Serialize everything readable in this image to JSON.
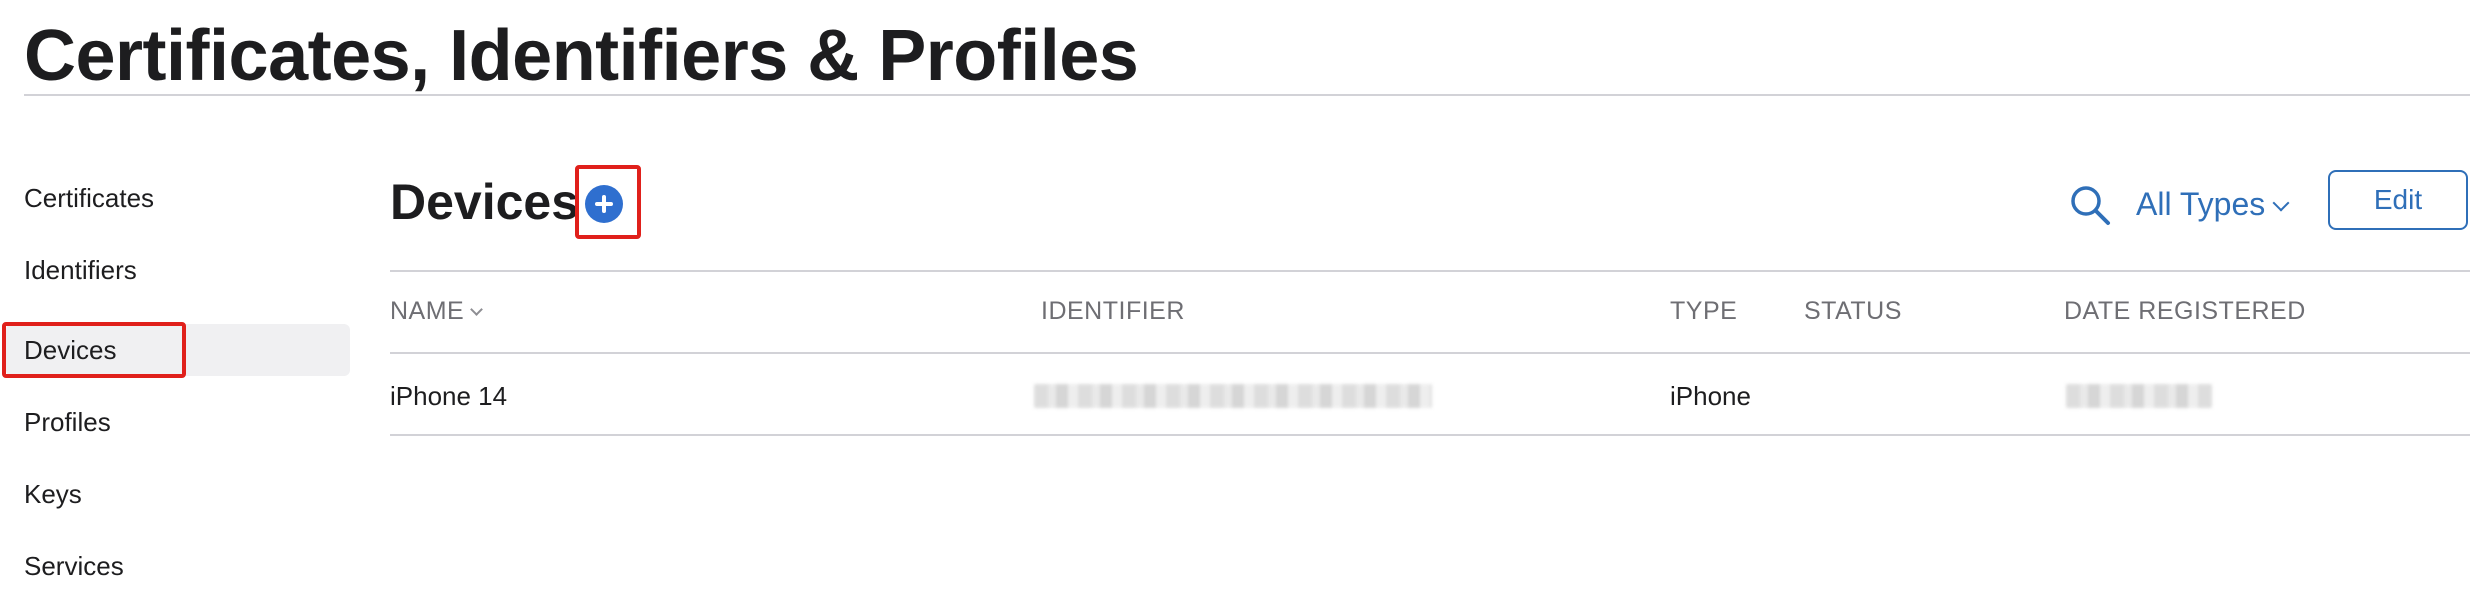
{
  "header": {
    "title": "Certificates, Identifiers & Profiles"
  },
  "sidebar": {
    "items": [
      {
        "label": "Certificates",
        "active": false
      },
      {
        "label": "Identifiers",
        "active": false
      },
      {
        "label": "Devices",
        "active": true
      },
      {
        "label": "Profiles",
        "active": false
      },
      {
        "label": "Keys",
        "active": false
      },
      {
        "label": "Services",
        "active": false
      }
    ]
  },
  "main": {
    "section_title": "Devices",
    "add_icon": "plus-circle-icon",
    "search_icon": "search-icon",
    "filter_value": "All Types",
    "edit_label": "Edit",
    "table": {
      "columns": [
        "NAME",
        "IDENTIFIER",
        "TYPE",
        "STATUS",
        "DATE REGISTERED"
      ],
      "rows": [
        {
          "name": "iPhone 14",
          "identifier": "",
          "type": "iPhone",
          "status": "",
          "date_registered": ""
        }
      ]
    }
  },
  "colors": {
    "accent": "#2f6fb8",
    "add_button": "#2f6fcf",
    "highlight": "#e0201b",
    "active_item_bg": "#f0f0f2"
  }
}
